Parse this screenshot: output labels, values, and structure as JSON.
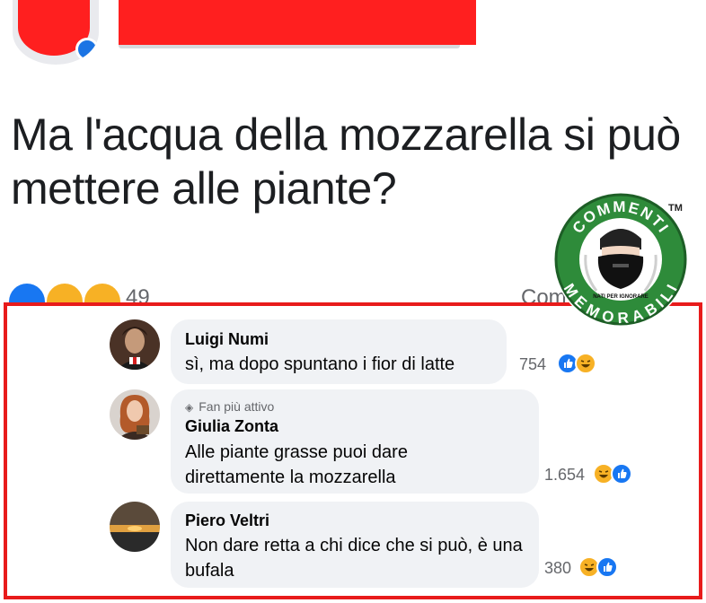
{
  "post": {
    "text": "Ma l'acqua della mozzarella si può mettere alle piante?",
    "reaction_count": "49",
    "comments_label": "Com"
  },
  "logo": {
    "top_text": "COMMENTI",
    "bottom_text": "MEMORABILI",
    "sub_text": "NATI PER IGNORARE",
    "tm": "TM"
  },
  "comments": [
    {
      "name": "Luigi Numi",
      "text": "sì, ma dopo spuntano i fior di latte",
      "reactions": "754",
      "icons": [
        "like-icon",
        "haha-icon"
      ]
    },
    {
      "badge": "Fan più attivo",
      "name": "Giulia Zonta",
      "text": "Alle piante grasse puoi dare direttamente la mozzarella",
      "reactions": "1.654",
      "icons": [
        "haha-icon",
        "like-icon"
      ]
    },
    {
      "name": "Piero Veltri",
      "text": "Non dare retta a chi dice che si può, è una bufala",
      "reactions": "380",
      "icons": [
        "haha-icon",
        "like-icon"
      ]
    }
  ],
  "colors": {
    "frame": "#e81b1b",
    "redaction": "#ff1f1f",
    "logo_green": "#2e8b3a",
    "like_blue": "#1877f2",
    "haha_yellow": "#f7b125",
    "bubble": "#f0f2f5"
  }
}
